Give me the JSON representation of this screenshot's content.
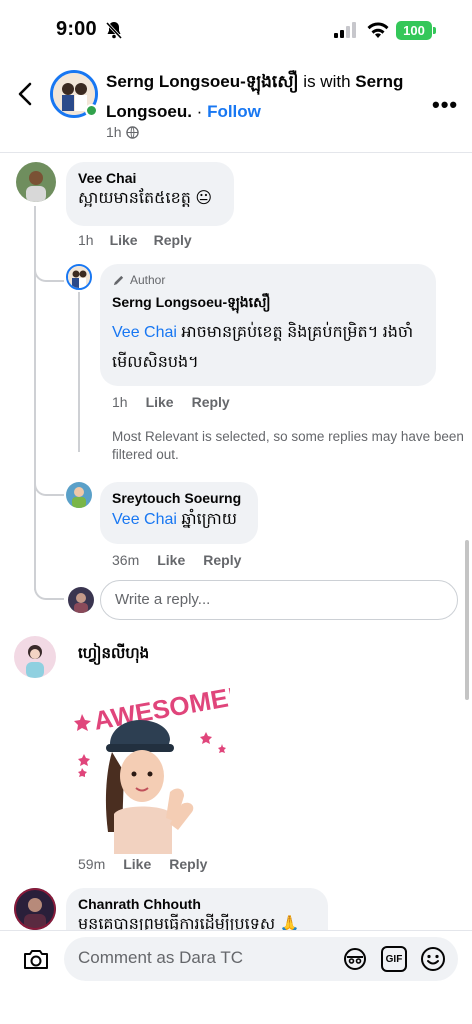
{
  "status_bar": {
    "time": "9:00",
    "battery": "100"
  },
  "header": {
    "author": "Serng Longsoeu-ឡុងសឿ",
    "with_text": " is with ",
    "with_name_part1": "Serng",
    "with_name_part2": "Longsoeu.",
    "separator": " · ",
    "follow_label": "Follow",
    "time": "1h"
  },
  "comments": {
    "vee": {
      "name": "Vee Chai",
      "text": "ស្អាយមានតែ៥ខេត្ត 😐",
      "time": "1h",
      "like": "Like",
      "reply": "Reply"
    },
    "author_reply": {
      "badge": "Author",
      "name": "Serng Longsoeu-ឡុងសឿ",
      "mention": "Vee Chai",
      "text_line1": " អាចមានគ្រប់ខេត្ត និងគ្រប់កម្រិត។ រងចាំ",
      "text_line2": "មើលសិនបង។",
      "time": "1h",
      "like": "Like",
      "reply": "Reply"
    },
    "filter_notice": "Most Relevant is selected, so some replies may have been filtered out.",
    "sreytouch": {
      "name": "Sreytouch Soeurng",
      "mention": "Vee Chai",
      "text": " ឆ្នាំក្រោយ",
      "time": "36m",
      "like": "Like",
      "reply": "Reply"
    },
    "reply_placeholder": "Write a reply...",
    "sticker_comment": {
      "name": "ហ្វៀនលីហុង",
      "sticker_text": "AWESOME!",
      "time": "59m",
      "like": "Like",
      "reply": "Reply"
    },
    "chanrath": {
      "name": "Chanrath Chhouth",
      "text": "មុនគេបានព្រមធ្វើការដើម្បីប្រទេស 🙏🙏"
    }
  },
  "composer": {
    "placeholder": "Comment as Dara TC",
    "gif_label": "GIF"
  },
  "colors": {
    "link": "#1877f2",
    "bubble": "#f0f2f5",
    "online": "#31a24c",
    "battery": "#34c759"
  }
}
